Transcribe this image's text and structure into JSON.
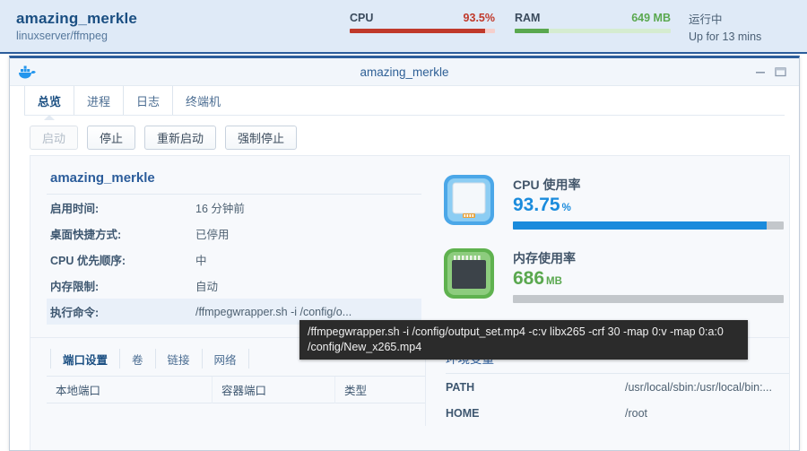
{
  "header": {
    "container_name": "amazing_merkle",
    "image_name": "linuxserver/ffmpeg",
    "cpu": {
      "label": "CPU",
      "value": "93.5%",
      "percent": 93.5,
      "color": "#c0392b"
    },
    "ram": {
      "label": "RAM",
      "value": "649 MB",
      "percent": 22,
      "color": "#5aa84f"
    },
    "status": {
      "state": "运行中",
      "uptime": "Up for 13 mins"
    }
  },
  "window": {
    "icon": "docker-whale-icon",
    "title": "amazing_merkle",
    "controls": {
      "minimize": "minimize-icon",
      "maximize": "maximize-icon"
    },
    "tabs": [
      {
        "label": "总览",
        "active": true
      },
      {
        "label": "进程",
        "active": false
      },
      {
        "label": "日志",
        "active": false
      },
      {
        "label": "终端机",
        "active": false
      }
    ]
  },
  "toolbar": {
    "buttons": [
      {
        "label": "启动",
        "disabled": true
      },
      {
        "label": "停止",
        "disabled": false
      },
      {
        "label": "重新启动",
        "disabled": false
      },
      {
        "label": "强制停止",
        "disabled": false
      }
    ]
  },
  "details": {
    "title": "amazing_merkle",
    "rows": [
      {
        "key": "启用时间:",
        "value": "16 分钟前",
        "highlight": false
      },
      {
        "key": "桌面快捷方式:",
        "value": "已停用",
        "highlight": false
      },
      {
        "key": "CPU 优先顺序:",
        "value": "中",
        "highlight": false
      },
      {
        "key": "内存限制:",
        "value": "自动",
        "highlight": false
      },
      {
        "key": "执行命令:",
        "value": "/ffmpegwrapper.sh -i /config/o...",
        "highlight": true
      }
    ]
  },
  "gauges": [
    {
      "icon": "cpu-chip-icon",
      "label": "CPU 使用率",
      "number": "93.75",
      "unit": "%",
      "percent": 93.75,
      "color": "#1a8bdc"
    },
    {
      "icon": "memory-chip-icon",
      "label": "内存使用率",
      "number": "686",
      "unit": "MB",
      "percent": 0,
      "color": "#5aa84f"
    }
  ],
  "ports_panel": {
    "tabs": [
      {
        "label": "端口设置",
        "active": true
      },
      {
        "label": "卷",
        "active": false
      },
      {
        "label": "链接",
        "active": false
      },
      {
        "label": "网络",
        "active": false
      }
    ],
    "columns": [
      "本地端口",
      "容器端口",
      "类型"
    ],
    "rows": []
  },
  "env_panel": {
    "title": "环境变量",
    "rows": [
      {
        "key": "PATH",
        "value": "/usr/local/sbin:/usr/local/bin:..."
      },
      {
        "key": "HOME",
        "value": "/root"
      }
    ]
  },
  "tooltip": {
    "text": "/ffmpegwrapper.sh -i /config/output_set.mp4 -c:v libx265 -crf 30 -map 0:v -map 0:a:0 /config/New_x265.mp4"
  }
}
